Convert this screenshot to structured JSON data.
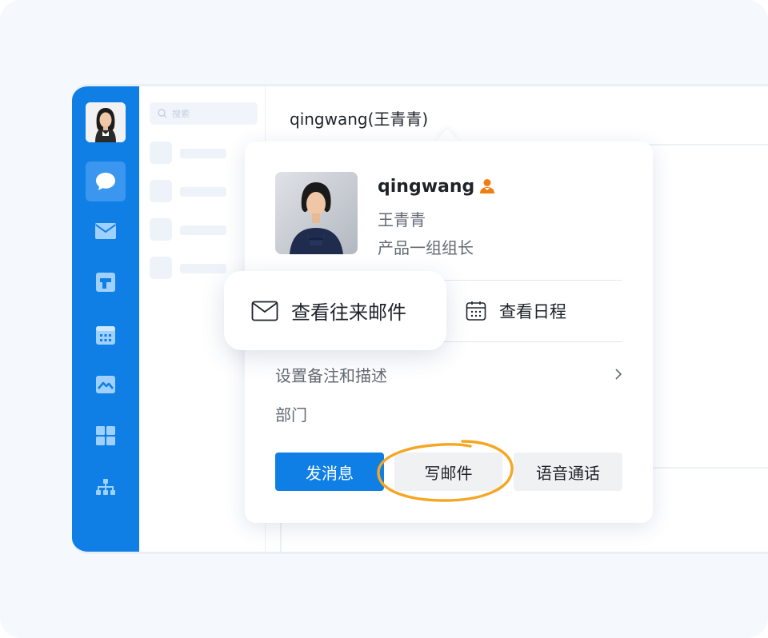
{
  "app": {
    "rail": {
      "items": [
        {
          "icon": "chat-bubble-icon",
          "active": true
        },
        {
          "icon": "mail-icon",
          "active": false
        },
        {
          "icon": "docs-icon",
          "active": false
        },
        {
          "icon": "calendar-icon",
          "active": false
        },
        {
          "icon": "workspace-icon",
          "active": false
        },
        {
          "icon": "apps-grid-icon",
          "active": false
        },
        {
          "icon": "org-chart-icon",
          "active": false
        }
      ]
    },
    "list": {
      "search_placeholder": "搜索"
    },
    "main": {
      "chat_title": "qingwang(王青青)"
    }
  },
  "profile_card": {
    "name": "qingwang",
    "display_name_cn": "王青青",
    "role": "产品一组组长",
    "admin_icon": "admin-person-icon",
    "actions": {
      "view_mails": "查看往来邮件",
      "view_schedule": "查看日程"
    },
    "settings_label": "设置备注和描述",
    "department_label": "部门",
    "buttons": {
      "send_message": "发消息",
      "write_mail": "写邮件",
      "voice_call": "语音通话"
    }
  },
  "colors": {
    "brand": "#0f7fe6",
    "highlight": "#f5a623",
    "admin_badge": "#f07d12"
  }
}
